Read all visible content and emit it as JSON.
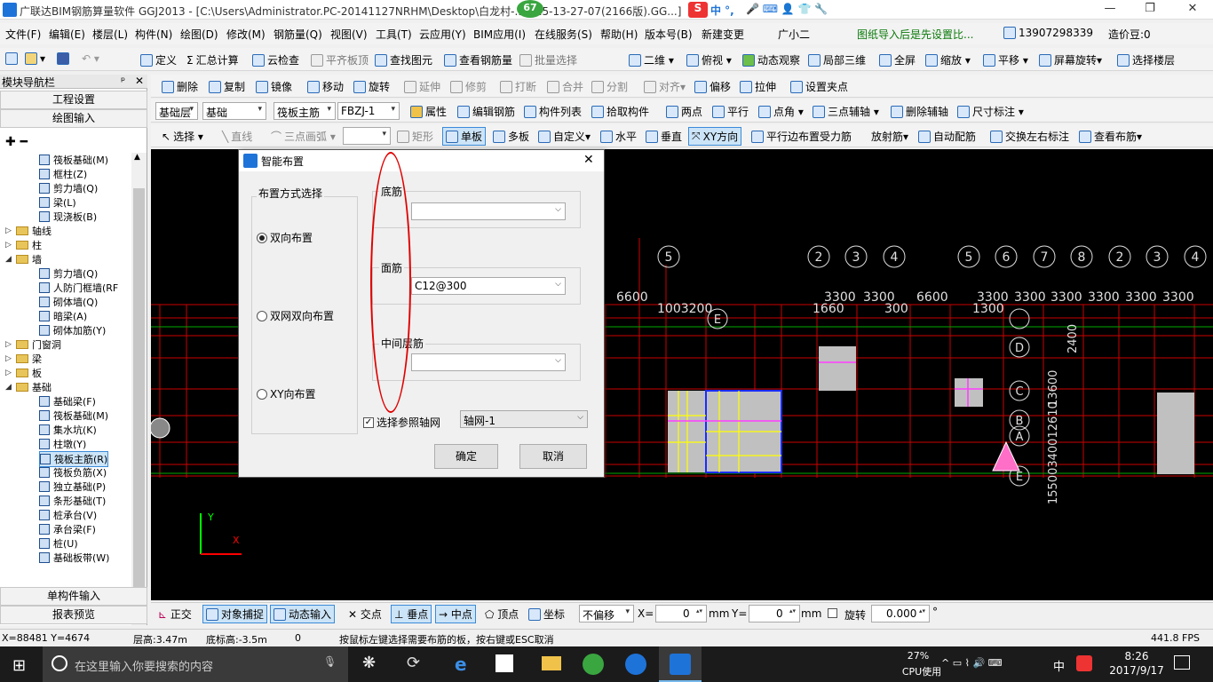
{
  "window": {
    "title": "广联达BIM钢筋算量软件 GGJ2013 - [C:\\Users\\Administrator.PC-20141127NRHM\\Desktop\\白龙村-...8-25-13-27-07(2166版).GG...]",
    "badge": "67",
    "ime_text": "中 °,",
    "min": "—",
    "restore": "❐",
    "close": "✕"
  },
  "menu": [
    "文件(F)",
    "编辑(E)",
    "楼层(L)",
    "构件(N)",
    "绘图(D)",
    "修改(M)",
    "钢筋量(Q)",
    "视图(V)",
    "工具(T)",
    "云应用(Y)",
    "BIM应用(I)",
    "在线服务(S)",
    "帮助(H)",
    "版本号(B)",
    "新建变更",
    "广小二"
  ],
  "menu_right": {
    "notice": "图纸导入后是先设置比...",
    "phone": "13907298339",
    "bean": "造价豆:0"
  },
  "toolbar1": [
    "定义",
    "汇总计算",
    "云检查",
    "平齐板顶",
    "查找图元",
    "查看钢筋量",
    "批量选择",
    "二维",
    "俯视",
    "动态观察",
    "局部三维",
    "全屏",
    "缩放",
    "平移",
    "屏幕旋转",
    "选择楼层"
  ],
  "toolbar2": [
    "删除",
    "复制",
    "镜像",
    "移动",
    "旋转",
    "延伸",
    "修剪",
    "打断",
    "合并",
    "分割",
    "对齐",
    "偏移",
    "拉伸",
    "设置夹点"
  ],
  "toolbar3": {
    "layer": "基础层",
    "cat": "基础",
    "type": "筏板主筋",
    "name": "FBZJ-1",
    "items": [
      "属性",
      "编辑钢筋",
      "构件列表",
      "拾取构件",
      "两点",
      "平行",
      "点角",
      "三点辅轴",
      "删除辅轴",
      "尺寸标注"
    ]
  },
  "toolbar4": [
    "选择",
    "直线",
    "三点画弧",
    "矩形",
    "单板",
    "多板",
    "自定义",
    "水平",
    "垂直",
    "XY方向",
    "平行边布置受力筋",
    "放射筋",
    "自动配筋",
    "交换左右标注",
    "查看布筋"
  ],
  "nav": {
    "title": "模块导航栏",
    "pin": "ᵖ",
    "close": "✕",
    "project_settings": "工程设置",
    "drawing_input": "绘图输入",
    "single_input": "单构件输入",
    "report": "报表预览"
  },
  "tree": [
    {
      "label": "筏板基础(M)",
      "level": 2,
      "type": "item"
    },
    {
      "label": "框柱(Z)",
      "level": 2,
      "type": "item"
    },
    {
      "label": "剪力墙(Q)",
      "level": 2,
      "type": "item"
    },
    {
      "label": "梁(L)",
      "level": 2,
      "type": "item"
    },
    {
      "label": "现浇板(B)",
      "level": 2,
      "type": "item"
    },
    {
      "label": "轴线",
      "level": 0,
      "type": "folder",
      "tog": "▷"
    },
    {
      "label": "柱",
      "level": 0,
      "type": "folder",
      "tog": "▷"
    },
    {
      "label": "墙",
      "level": 0,
      "type": "folder",
      "tog": "◢"
    },
    {
      "label": "剪力墙(Q)",
      "level": 2,
      "type": "item"
    },
    {
      "label": "人防门框墙(RF",
      "level": 2,
      "type": "item"
    },
    {
      "label": "砌体墙(Q)",
      "level": 2,
      "type": "item"
    },
    {
      "label": "暗梁(A)",
      "level": 2,
      "type": "item"
    },
    {
      "label": "砌体加筋(Y)",
      "level": 2,
      "type": "item"
    },
    {
      "label": "门窗洞",
      "level": 0,
      "type": "folder",
      "tog": "▷"
    },
    {
      "label": "梁",
      "level": 0,
      "type": "folder",
      "tog": "▷"
    },
    {
      "label": "板",
      "level": 0,
      "type": "folder",
      "tog": "▷"
    },
    {
      "label": "基础",
      "level": 0,
      "type": "folder",
      "tog": "◢"
    },
    {
      "label": "基础梁(F)",
      "level": 2,
      "type": "item"
    },
    {
      "label": "筏板基础(M)",
      "level": 2,
      "type": "item"
    },
    {
      "label": "集水坑(K)",
      "level": 2,
      "type": "item"
    },
    {
      "label": "柱墩(Y)",
      "level": 2,
      "type": "item"
    },
    {
      "label": "筏板主筋(R)",
      "level": 2,
      "type": "item",
      "selected": true
    },
    {
      "label": "筏板负筋(X)",
      "level": 2,
      "type": "item"
    },
    {
      "label": "独立基础(P)",
      "level": 2,
      "type": "item"
    },
    {
      "label": "条形基础(T)",
      "level": 2,
      "type": "item"
    },
    {
      "label": "桩承台(V)",
      "level": 2,
      "type": "item"
    },
    {
      "label": "承台梁(F)",
      "level": 2,
      "type": "item"
    },
    {
      "label": "桩(U)",
      "level": 2,
      "type": "item"
    },
    {
      "label": "基础板带(W)",
      "level": 2,
      "type": "item"
    }
  ],
  "dialog": {
    "title": "智能布置",
    "close": "✕",
    "group_label": "布置方式选择",
    "options": [
      "双向布置",
      "双网双向布置",
      "XY向布置"
    ],
    "selected": 0,
    "bottom_label": "底筋",
    "bottom_value": "",
    "top_label": "面筋",
    "top_value": "C12@300",
    "middle_label": "中间层筋",
    "middle_value": "",
    "ref_axis_label": "选择参照轴网",
    "ref_axis_value": "轴网-1",
    "ok": "确定",
    "cancel": "取消"
  },
  "cad": {
    "axis_top": [
      "5",
      "2",
      "3",
      "4",
      "5",
      "6",
      "7",
      "8",
      "2",
      "3",
      "4"
    ],
    "dims": [
      "6600",
      "1003200",
      "3300",
      "3300",
      "1660",
      "300",
      "6600",
      "1300",
      "3300",
      "3300",
      "3300",
      "3300",
      "3300",
      "3300"
    ],
    "axis_side": [
      "E",
      "D",
      "C",
      "B",
      "A",
      "E"
    ],
    "vertical_dims": [
      "13600",
      "2400",
      "15500340012610"
    ]
  },
  "status2": {
    "items": [
      "正交",
      "对象捕捉",
      "动态输入",
      "交点",
      "垂点",
      "中点",
      "顶点",
      "坐标"
    ],
    "offset": "不偏移",
    "x_label": "X=",
    "x_val": "0",
    "y_label": "Y=",
    "y_val": "0",
    "unit": "mm",
    "rotate_label": "旋转",
    "rotate_val": "0.000",
    "deg": "°"
  },
  "status": {
    "coords": "X=88481 Y=4674",
    "floor_h": "层高:3.47m",
    "base_h": "底标高:-3.5m",
    "zero": "0",
    "hint": "按鼠标左键选择需要布筋的板，按右键或ESC取消",
    "fps": "441.8 FPS"
  },
  "taskbar": {
    "search": "在这里输入你要搜索的内容",
    "cpu_pct": "27%",
    "cpu_label": "CPU使用",
    "ime": "中",
    "time": "8:26",
    "date": "2017/9/17"
  },
  "colors": {
    "accent": "#1e73d8",
    "cad_bg": "#000000",
    "red": "#cc0000",
    "annotation": "#e00000"
  }
}
